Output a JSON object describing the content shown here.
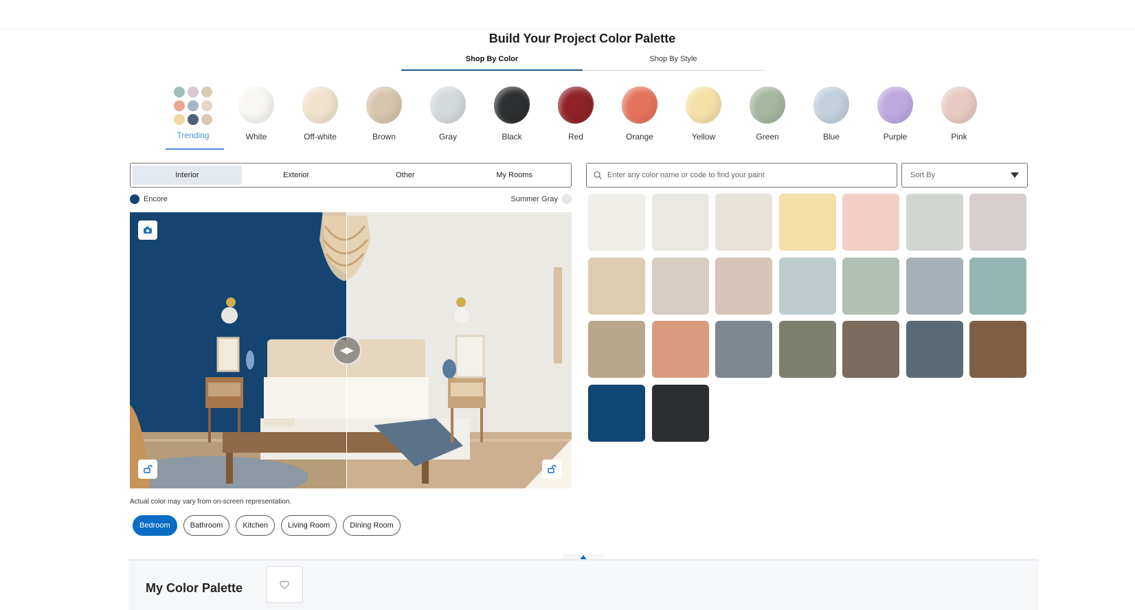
{
  "header": {
    "title": "Build Your Project Color Palette",
    "tabs": [
      {
        "label": "Shop By Color",
        "active": true
      },
      {
        "label": "Shop By Style",
        "active": false
      }
    ]
  },
  "families": [
    {
      "label": "Trending",
      "color": "#b9c8c8",
      "active": true
    },
    {
      "label": "White",
      "color": "#f7f6f2"
    },
    {
      "label": "Off-white",
      "color": "#efe3cc"
    },
    {
      "label": "Brown",
      "color": "#d8c5ad"
    },
    {
      "label": "Gray",
      "color": "#d4d9dc"
    },
    {
      "label": "Black",
      "color": "#2d2f31"
    },
    {
      "label": "Red",
      "color": "#8f2327"
    },
    {
      "label": "Orange",
      "color": "#e5735c"
    },
    {
      "label": "Yellow",
      "color": "#f5e0a8"
    },
    {
      "label": "Green",
      "color": "#a6b79e"
    },
    {
      "label": "Blue",
      "color": "#c1d0dc"
    },
    {
      "label": "Purple",
      "color": "#bda9de"
    },
    {
      "label": "Pink",
      "color": "#e8cac2"
    }
  ],
  "room_types": [
    {
      "label": "Interior",
      "active": true
    },
    {
      "label": "Exterior"
    },
    {
      "label": "Other"
    },
    {
      "label": "My Rooms"
    }
  ],
  "preview": {
    "left_color_name": "Encore",
    "left_color": "#14446f",
    "right_color_name": "Summer Gray",
    "right_color": "#ebe9e3",
    "disclaimer": "Actual color may vary from on-screen representation."
  },
  "rooms": [
    {
      "label": "Bedroom",
      "active": true
    },
    {
      "label": "Bathroom"
    },
    {
      "label": "Kitchen"
    },
    {
      "label": "Living Room"
    },
    {
      "label": "Dining Room"
    }
  ],
  "search": {
    "placeholder": "Enter any color name or code to find your paint",
    "value": ""
  },
  "sort": {
    "label": "Sort By"
  },
  "swatches": [
    "#f0eee8",
    "#eae8e3",
    "#e9e4da",
    "#f5dfa8",
    "#f2cfc4",
    "#d1d6d0",
    "#d7cfcd",
    "#dfcbb1",
    "#d5cdc2",
    "#d7c4b7",
    "#bccbcc",
    "#b2bfb4",
    "#a7b0b6",
    "#93b6b2",
    "#baa78b",
    "#d99b7e",
    "#7d8891",
    "#7c7f6c",
    "#7c6c5e",
    "#586a76",
    "#7f5e45",
    "#0f4674",
    "#2c2d30"
  ],
  "palette": {
    "title": "My Color Palette"
  }
}
